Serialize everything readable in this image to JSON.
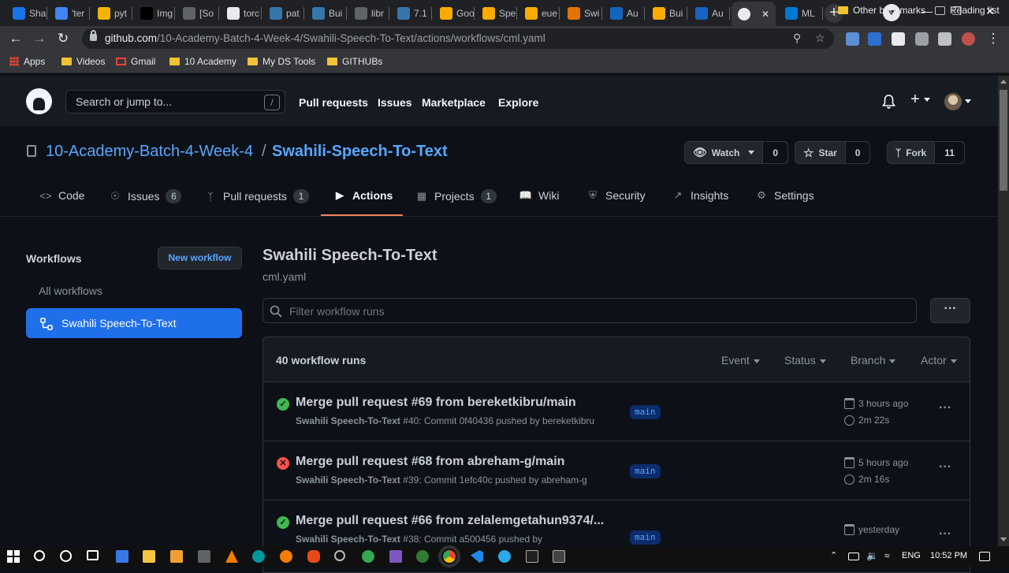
{
  "browser": {
    "tabs": [
      {
        "label": "Sha",
        "color": "#1a73e8"
      },
      {
        "label": "'ter",
        "color": "#4285f4"
      },
      {
        "label": "pyt",
        "color": "#f4b400"
      },
      {
        "label": "Img",
        "color": "#000000"
      },
      {
        "label": "[So",
        "color": "#5f6368"
      },
      {
        "label": "torc",
        "color": "#e8eaed"
      },
      {
        "label": "pat",
        "color": "#3776ab"
      },
      {
        "label": "Bui",
        "color": "#3776ab"
      },
      {
        "label": "libr",
        "color": "#5f6368"
      },
      {
        "label": "7.1",
        "color": "#3776ab"
      },
      {
        "label": "Goo",
        "color": "#f9ab00"
      },
      {
        "label": "Spe",
        "color": "#f9ab00"
      },
      {
        "label": "eue",
        "color": "#f9ab00"
      },
      {
        "label": "Swi",
        "color": "#e37400"
      },
      {
        "label": "Au",
        "color": "#1565c0"
      },
      {
        "label": "Bui",
        "color": "#f9ab00"
      },
      {
        "label": "Au",
        "color": "#1565c0"
      },
      {
        "label": "",
        "color": "#e8eaed",
        "active": true
      },
      {
        "label": "ML",
        "color": "#0078d4"
      }
    ],
    "url_host": "github.com",
    "url_path": "/10-Academy-Batch-4-Week-4/Swahili-Speech-To-Text/actions/workflows/cml.yaml",
    "bookmarks": [
      {
        "label": "Apps",
        "type": "apps"
      },
      {
        "label": "Videos",
        "type": "folder"
      },
      {
        "label": "Gmail",
        "type": "gmail"
      },
      {
        "label": "10 Academy",
        "type": "folder"
      },
      {
        "label": "My DS Tools",
        "type": "folder"
      },
      {
        "label": "GITHUBs",
        "type": "folder"
      }
    ],
    "other_bookmarks": "Other bookmarks",
    "reading_list": "Reading list"
  },
  "github": {
    "search_placeholder": "Search or jump to...",
    "search_shortcut": "/",
    "nav": [
      "Pull requests",
      "Issues",
      "Marketplace",
      "Explore"
    ],
    "repo_owner": "10-Academy-Batch-4-Week-4",
    "repo_sep": "/",
    "repo_name": "Swahili-Speech-To-Text",
    "watch_label": "Watch",
    "watch_count": "0",
    "star_label": "Star",
    "star_count": "0",
    "fork_label": "Fork",
    "fork_count": "11",
    "tabs": [
      {
        "label": "Code",
        "icon": "code-icon",
        "count": ""
      },
      {
        "label": "Issues",
        "icon": "issue-icon",
        "count": "6"
      },
      {
        "label": "Pull requests",
        "icon": "pull-request-icon",
        "count": "1"
      },
      {
        "label": "Actions",
        "icon": "play-icon",
        "count": ""
      },
      {
        "label": "Projects",
        "icon": "project-icon",
        "count": "1"
      },
      {
        "label": "Wiki",
        "icon": "book-icon",
        "count": ""
      },
      {
        "label": "Security",
        "icon": "shield-icon",
        "count": ""
      },
      {
        "label": "Insights",
        "icon": "graph-icon",
        "count": ""
      },
      {
        "label": "Settings",
        "icon": "gear-icon",
        "count": ""
      }
    ],
    "active_tab": "Actions"
  },
  "sidebar": {
    "title": "Workflows",
    "new_workflow": "New workflow",
    "all_workflows": "All workflows",
    "active_workflow": "Swahili Speech-To-Text"
  },
  "main": {
    "title": "Swahili Speech-To-Text",
    "file": "cml.yaml",
    "filter_placeholder": "Filter workflow runs",
    "runs_count": "40 workflow runs",
    "filters": [
      "Event",
      "Status",
      "Branch",
      "Actor"
    ],
    "runs": [
      {
        "status": "success",
        "title": "Merge pull request #69 from bereketkibru/main",
        "workflow": "Swahili Speech-To-Text",
        "detail": "#40: Commit 0f40436 pushed by bereketkibru",
        "branch": "main",
        "when": "3 hours ago",
        "duration": "2m 22s"
      },
      {
        "status": "failure",
        "title": "Merge pull request #68 from abreham-g/main",
        "workflow": "Swahili Speech-To-Text",
        "detail": "#39: Commit 1efc40c pushed by abreham-g",
        "branch": "main",
        "when": "5 hours ago",
        "duration": "2m 16s"
      },
      {
        "status": "success",
        "title": "Merge pull request #66 from zelalemgetahun9374/...",
        "workflow": "Swahili Speech-To-Text",
        "detail": "#38: Commit a500456 pushed by",
        "branch": "main",
        "when": "yesterday",
        "duration": ""
      }
    ],
    "colors": {
      "success": "#3fb950",
      "failure": "#f85149",
      "accent": "#1f6feb",
      "link": "#58a6ff"
    }
  },
  "taskbar": {
    "lang": "ENG",
    "time": "10:52 PM"
  }
}
